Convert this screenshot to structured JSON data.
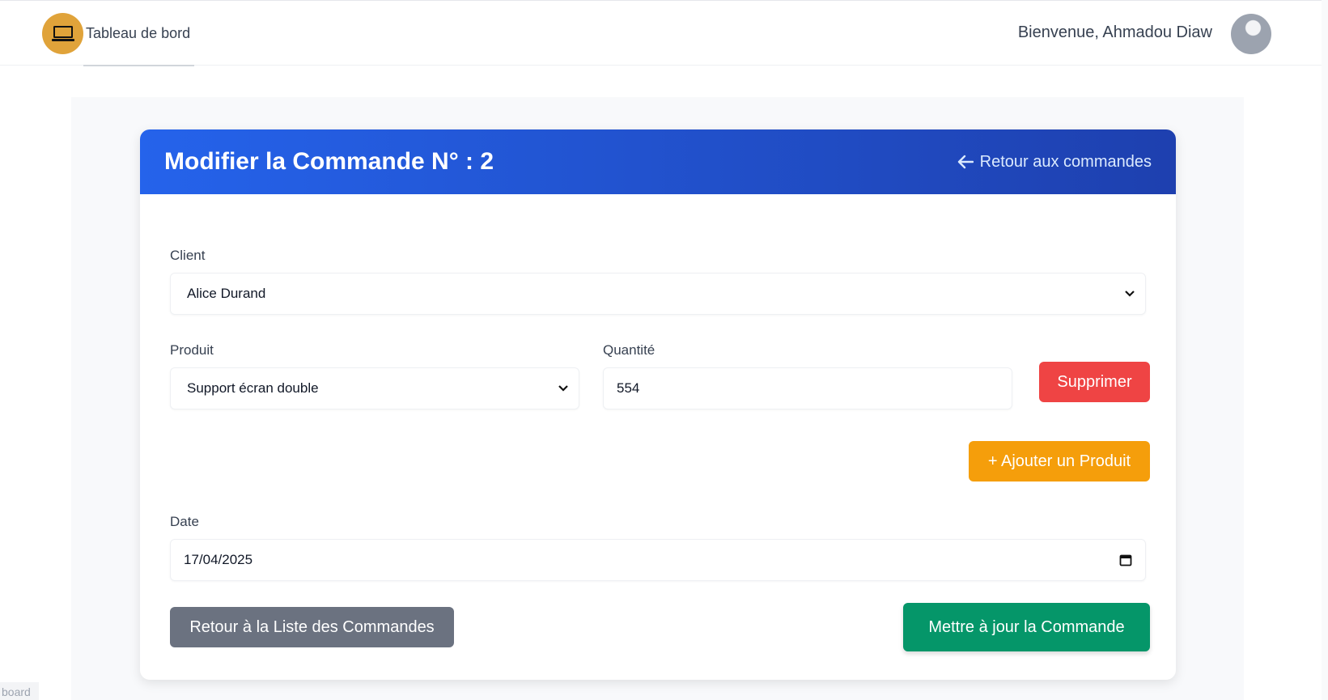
{
  "header": {
    "brand_label": "Tableau de bord",
    "welcome_text": "Bienvenue, Ahmadou Diaw"
  },
  "card": {
    "title": "Modifier la Commande N° : 2",
    "back_link_label": "Retour aux commandes"
  },
  "form": {
    "client_label": "Client",
    "client_value": "Alice Durand",
    "product_label": "Produit",
    "product_value": "Support écran double",
    "quantity_label": "Quantité",
    "quantity_value": "554",
    "delete_label": "Supprimer",
    "add_product_label": "+ Ajouter un Produit",
    "date_label": "Date",
    "date_value": "17/04/2025",
    "back_to_list_label": "Retour à la Liste des Commandes",
    "update_label": "Mettre à jour la Commande"
  },
  "footer": {
    "tag_text": "board"
  },
  "colors": {
    "header_gradient_start": "#2563eb",
    "header_gradient_end": "#1e40af",
    "delete": "#ef4444",
    "add": "#f59e0b",
    "back": "#6b7280",
    "update": "#059669",
    "logo_bg": "#e0a33a"
  },
  "icons": [
    "laptop-logo-icon",
    "arrow-left-icon",
    "chevron-down-icon",
    "calendar-icon"
  ]
}
